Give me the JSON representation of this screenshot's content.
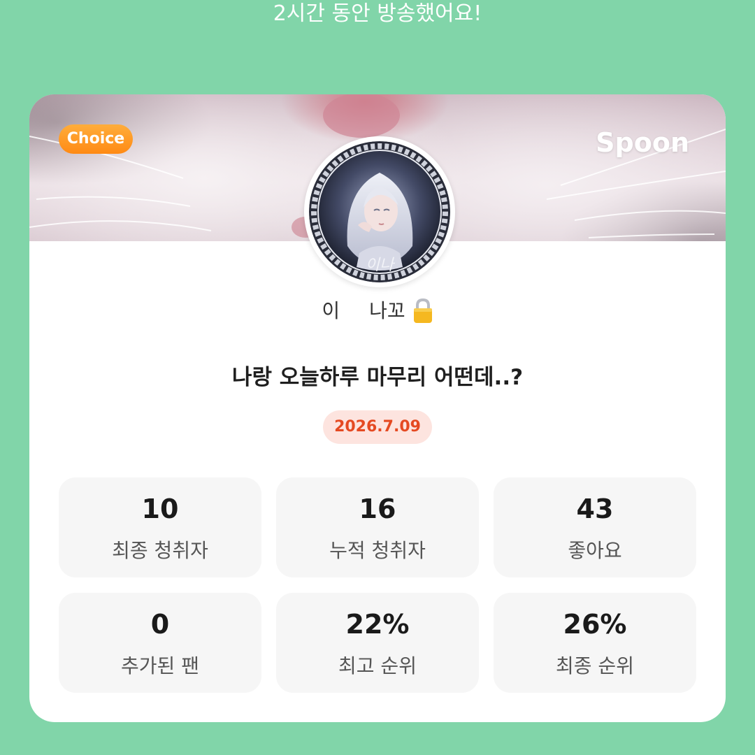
{
  "headline": "2시간 동안 방송했어요!",
  "card": {
    "badge": "Choice",
    "brand": "Spoon",
    "avatar_caption": "이나",
    "nickname": {
      "first": "이",
      "second": "나꼬",
      "icon": "lock-icon"
    },
    "title": "나랑 오늘하루 마무리 어떤데..?",
    "date": "2026.7.09",
    "stats": [
      {
        "value": "10",
        "label": "최종 청취자"
      },
      {
        "value": "16",
        "label": "누적 청취자"
      },
      {
        "value": "43",
        "label": "좋아요"
      },
      {
        "value": "0",
        "label": "추가된 팬"
      },
      {
        "value": "22%",
        "label": "최고 순위"
      },
      {
        "value": "26%",
        "label": "최종 순위"
      }
    ]
  },
  "colors": {
    "background": "#81d5a9",
    "badge": "#ff8a14",
    "date_text": "#e54a22",
    "date_bg": "#fde4df"
  }
}
